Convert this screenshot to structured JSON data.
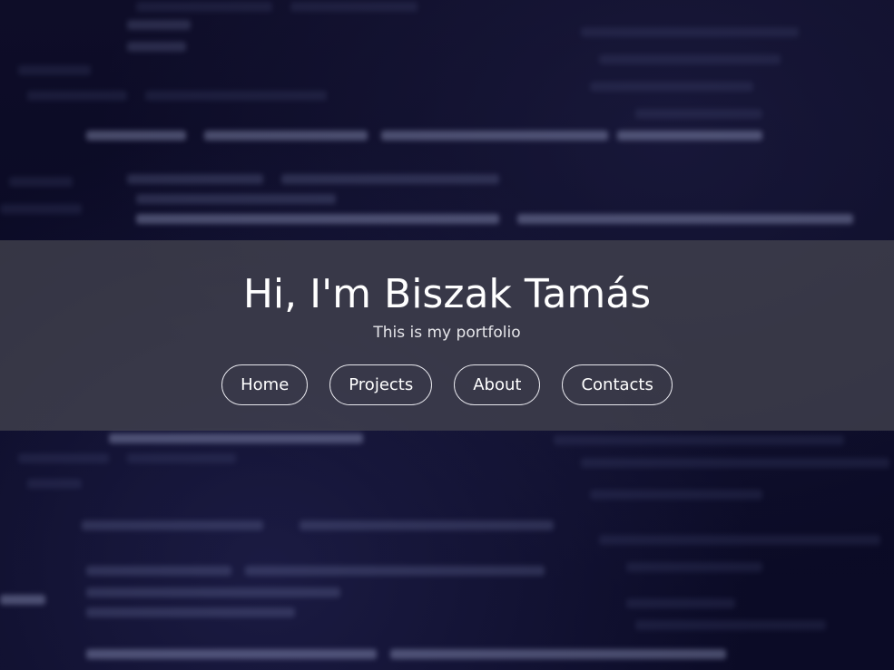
{
  "hero": {
    "title": "Hi, I'm Biszak Tamás",
    "subtitle": "This is my portfolio"
  },
  "nav": {
    "items": [
      {
        "label": "Home"
      },
      {
        "label": "Projects"
      },
      {
        "label": "About"
      },
      {
        "label": "Contacts"
      }
    ]
  },
  "colors": {
    "background": "#0b0a22",
    "banner_overlay": "rgba(70,70,80,0.72)",
    "text": "#ffffff",
    "button_border": "#e8e8ee"
  }
}
